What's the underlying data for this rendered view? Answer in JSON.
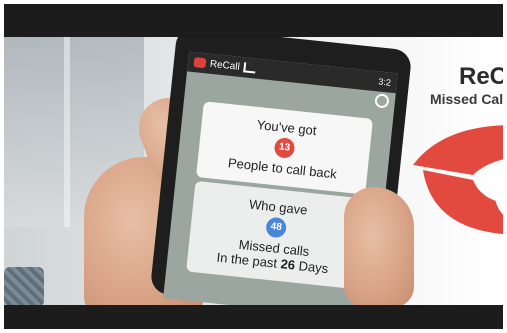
{
  "phone": {
    "app_title": "ReCall",
    "status_time": "3:2"
  },
  "card_primary": {
    "line1": "You've got",
    "badge_count": "13",
    "line2": "People to call back"
  },
  "card_secondary": {
    "line1": "Who gave",
    "badge_count": "48",
    "line2": "Missed calls",
    "line3_prefix": "In the past",
    "line3_days": "26",
    "line3_suffix": "Days"
  },
  "brand": {
    "title": "ReC",
    "subtitle": "Missed Call"
  },
  "colors": {
    "accent_red": "#e24a3f",
    "accent_blue": "#4a86d8"
  },
  "icons": {
    "phone_logo": "phone-handset-icon",
    "settings": "gear-icon",
    "app": "phone-icon",
    "wifi": "wifi-icon",
    "signal": "signal-icon",
    "battery": "battery-icon"
  }
}
